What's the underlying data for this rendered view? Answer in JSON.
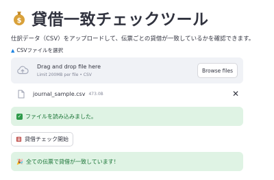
{
  "header": {
    "icon": "money-bag-icon",
    "title": "貸借一致チェックツール"
  },
  "description": "仕訳データ（CSV）をアップロードして、伝票ごとの貸借が一致しているかを確認できます。",
  "uploader": {
    "label_icon": "upload-arrow-icon",
    "label": "CSVファイルを選択",
    "drop_title": "Drag and drop file here",
    "drop_subtitle": "Limit 200MB per file • CSV",
    "browse_label": "Browse files"
  },
  "file": {
    "name": "journal_sample.csv",
    "size": "473.0B",
    "close_symbol": "✕"
  },
  "alerts": {
    "loaded": "ファイルを読み込みました。",
    "result": "全ての伝票で貸借が一致しています！"
  },
  "run_button": {
    "label": "貸借チェック開始"
  },
  "colors": {
    "primary_text": "#31333f",
    "success_bg": "#dff3e4",
    "success_text": "#177233",
    "dropzone_bg": "#f0f2f6"
  }
}
